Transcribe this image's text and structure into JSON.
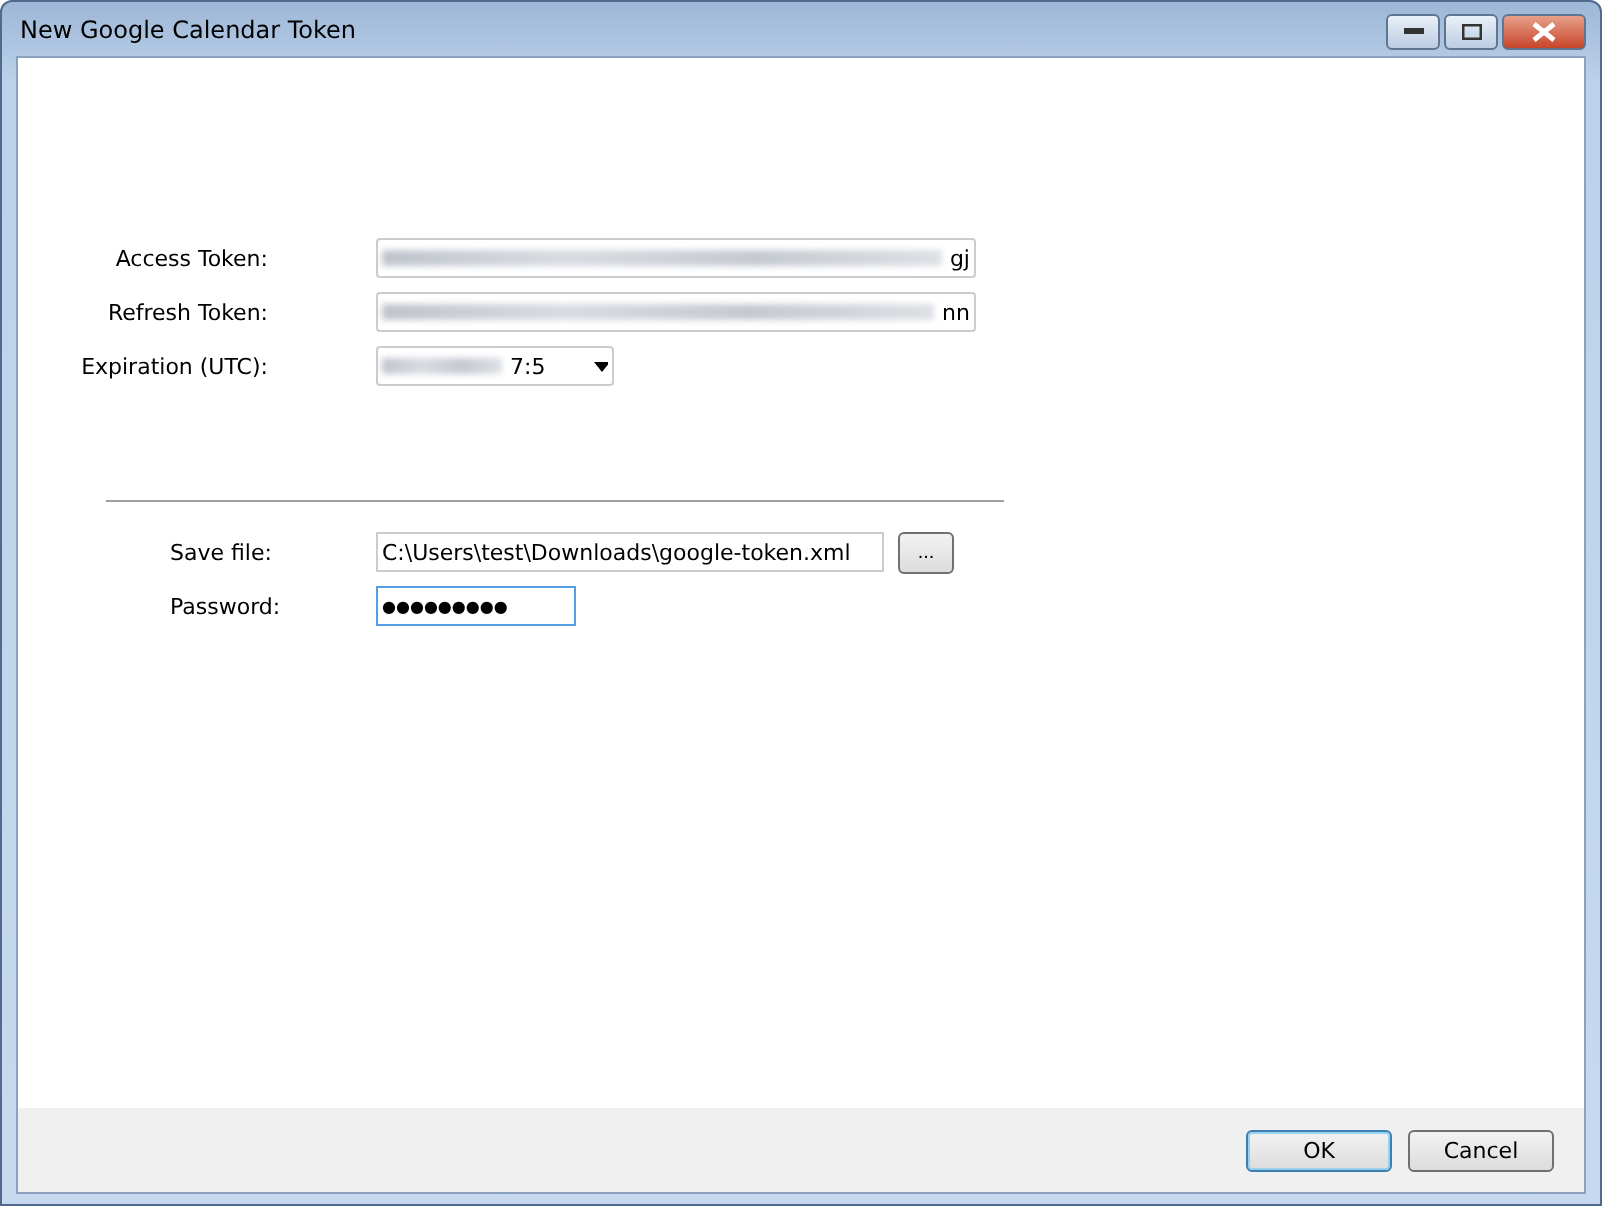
{
  "window": {
    "title": "New Google Calendar Token"
  },
  "token_fields": [
    {
      "label": "Access Token:",
      "visible_tail": "gj"
    },
    {
      "label": "Refresh Token:",
      "visible_tail": "nn"
    }
  ],
  "expiration": {
    "label": "Expiration (UTC):",
    "visible_tail": "7:5"
  },
  "save_file": {
    "label": "Save file:",
    "value": "C:\\Users\\test\\Downloads\\google-token.xml",
    "browse_button": "..."
  },
  "password": {
    "label": "Password:",
    "value": "●●●●●●●●●"
  },
  "buttons": [
    {
      "label": "OK",
      "default": true
    },
    {
      "label": "Cancel",
      "default": false
    }
  ]
}
